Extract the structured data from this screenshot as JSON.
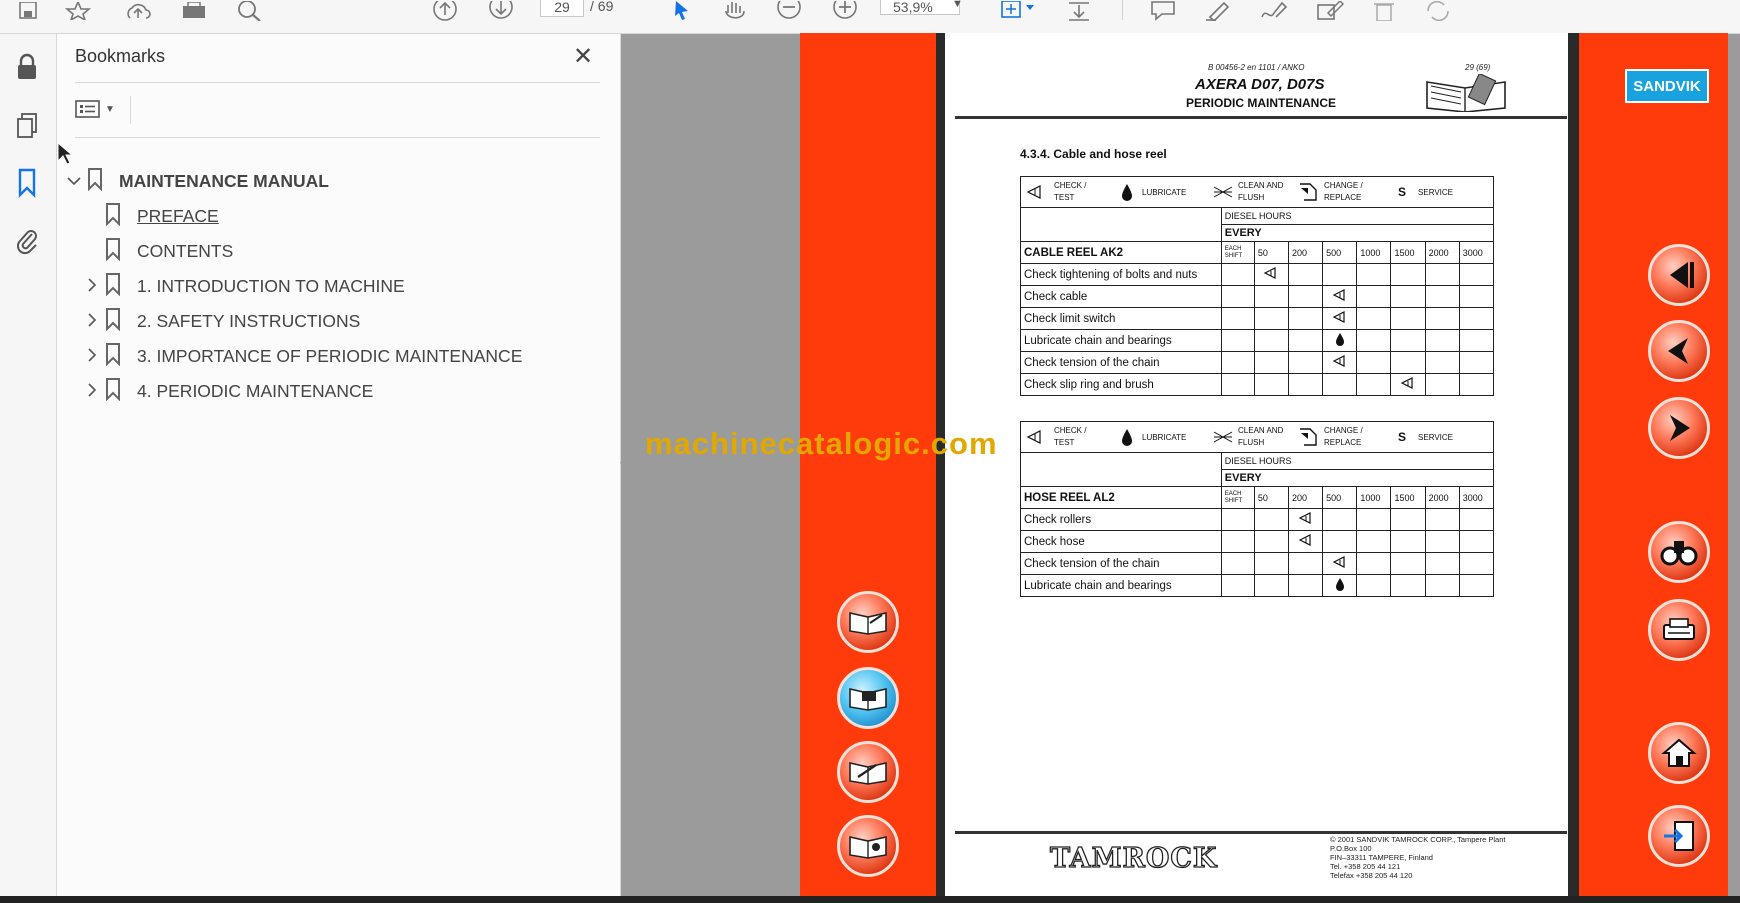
{
  "toolbar": {
    "page_current": "29",
    "page_total": "/ 69",
    "zoom": "53,9%"
  },
  "bookmarks": {
    "title": "Bookmarks",
    "items": [
      {
        "label": "MAINTENANCE MANUAL",
        "level": 0,
        "expanded": true
      },
      {
        "label": "PREFACE",
        "level": 1
      },
      {
        "label": "CONTENTS",
        "level": 1
      },
      {
        "label": "1. INTRODUCTION TO MACHINE",
        "level": 1,
        "collapsed": true
      },
      {
        "label": "2. SAFETY INSTRUCTIONS",
        "level": 1,
        "collapsed": true
      },
      {
        "label": "3. IMPORTANCE OF PERIODIC MAINTENANCE",
        "level": 1,
        "collapsed": true
      },
      {
        "label": "4. PERIODIC MAINTENANCE",
        "level": 1,
        "collapsed": true
      }
    ]
  },
  "watermark": "machinecatalogic.com",
  "document": {
    "doc_code": "B 00456-2 en 1101 / ANKO",
    "page_ref": "29 (69)",
    "title": "AXERA D07, D07S",
    "subtitle": "PERIODIC MAINTENANCE",
    "section": "4.3.4.    Cable and hose reel",
    "legend": {
      "check": "CHECK /",
      "test": "TEST",
      "lubricate": "LUBRICATE",
      "clean": "CLEAN AND",
      "flush": "FLUSH",
      "change": "CHANGE    /",
      "replace": "REPLACE",
      "s": "S",
      "service": "SERVICE"
    },
    "diesel_hours": "DIESEL HOURS",
    "every": "EVERY",
    "each_shift": "EACH SHIFT",
    "hour_cols": [
      "50",
      "200",
      "500",
      "1000",
      "1500",
      "2000",
      "3000"
    ],
    "tables": [
      {
        "heading": "CABLE REEL AK2",
        "rows": [
          {
            "label": "Check tightening of bolts and nuts",
            "col": 1,
            "mark": "check"
          },
          {
            "label": "Check cable",
            "col": 3,
            "mark": "check"
          },
          {
            "label": "Check limit switch",
            "col": 3,
            "mark": "check"
          },
          {
            "label": "Lubricate chain and bearings",
            "col": 3,
            "mark": "lube"
          },
          {
            "label": "Check tension of the chain",
            "col": 3,
            "mark": "check"
          },
          {
            "label": "Check slip ring and brush",
            "col": 5,
            "mark": "check"
          }
        ]
      },
      {
        "heading": "HOSE REEL AL2",
        "rows": [
          {
            "label": "Check rollers",
            "col": 2,
            "mark": "check"
          },
          {
            "label": "Check hose",
            "col": 2,
            "mark": "check"
          },
          {
            "label": "Check tension of the chain",
            "col": 3,
            "mark": "check"
          },
          {
            "label": "Lubricate chain and bearings",
            "col": 3,
            "mark": "lube"
          }
        ]
      }
    ],
    "footer": {
      "logo": "TAMROCK",
      "copyright": "©  2001  SANDVIK TAMROCK CORP., Tampere Plant",
      "po": "P.O.Box 100",
      "city": "FIN–33311 TAMPERE, Finland",
      "tel": "Tel. +358 205 44 121",
      "fax": "Telefax +358 205 44 120"
    },
    "brand": "SANDVIK"
  },
  "colors": {
    "strip": "#ff3b0b",
    "accent_blue": "#1473e6",
    "watermark": "#e0a800"
  }
}
